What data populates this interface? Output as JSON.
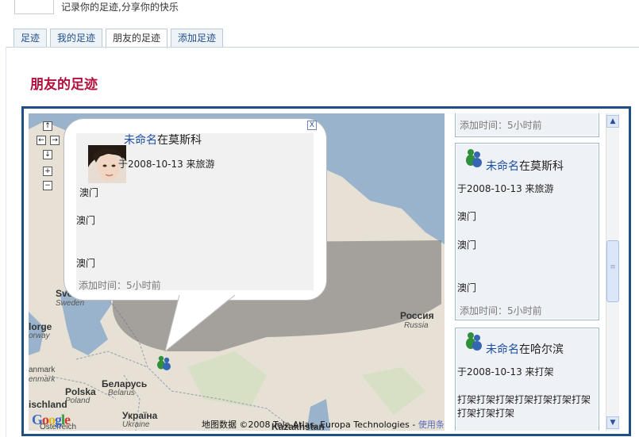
{
  "header": {
    "tagline": "记录你的足迹,分享你的快乐"
  },
  "tabs": [
    {
      "label": "足迹",
      "active": false
    },
    {
      "label": "我的足迹",
      "active": false
    },
    {
      "label": "朋友的足迹",
      "active": true
    },
    {
      "label": "添加足迹",
      "active": false
    }
  ],
  "page_title": "朋友的足迹",
  "map": {
    "controls": {
      "up": "↑",
      "left": "←",
      "right": "→",
      "down": "↓",
      "zoom_in": "+",
      "zoom_out": "−"
    },
    "labels": {
      "russia": "Россия",
      "russia_latin": "Russia",
      "sweden": "Sve",
      "sweden_latin": "Sweden",
      "norway": "lorge",
      "norway_latin": "orway",
      "denmark": "anmark",
      "denmark_latin": "enmark",
      "poland": "Polska",
      "poland_latin": "Poland",
      "belarus": "Беларусь",
      "belarus_latin": "Belarus",
      "ukraine": "Україна",
      "ukraine_latin": "Ukraine",
      "germany": "ischland",
      "austria": "Österreich",
      "kazakhstan": "Kazakhstan"
    },
    "google_logo": "Google",
    "copyright": "地图数据 ©2008 Tele Atlas, Europa Technologies - ",
    "terms": "使用条款"
  },
  "popup": {
    "name": "未命名",
    "place": "在莫斯科",
    "date_line": "于2008-10-13 来旅游",
    "lines": [
      "澳门",
      "澳门",
      "澳门"
    ],
    "added": "添加时间：5小时前",
    "close": "X"
  },
  "feed": {
    "top_added": "添加时间：5小时前",
    "items": [
      {
        "name": "未命名",
        "place": "在莫斯科",
        "date_line": "于2008-10-13 来旅游",
        "lines": [
          "澳门",
          "澳门",
          "澳门"
        ],
        "added": "添加时间：5小时前"
      },
      {
        "name": "未命名",
        "place": "在哈尔滨",
        "date_line": "于2008-10-13 来打架",
        "body": "打架打架打架打架打架打架打架打架打架打架"
      }
    ]
  },
  "scrollbar": {
    "up": "▲",
    "down": "▼",
    "grip": "≡"
  }
}
